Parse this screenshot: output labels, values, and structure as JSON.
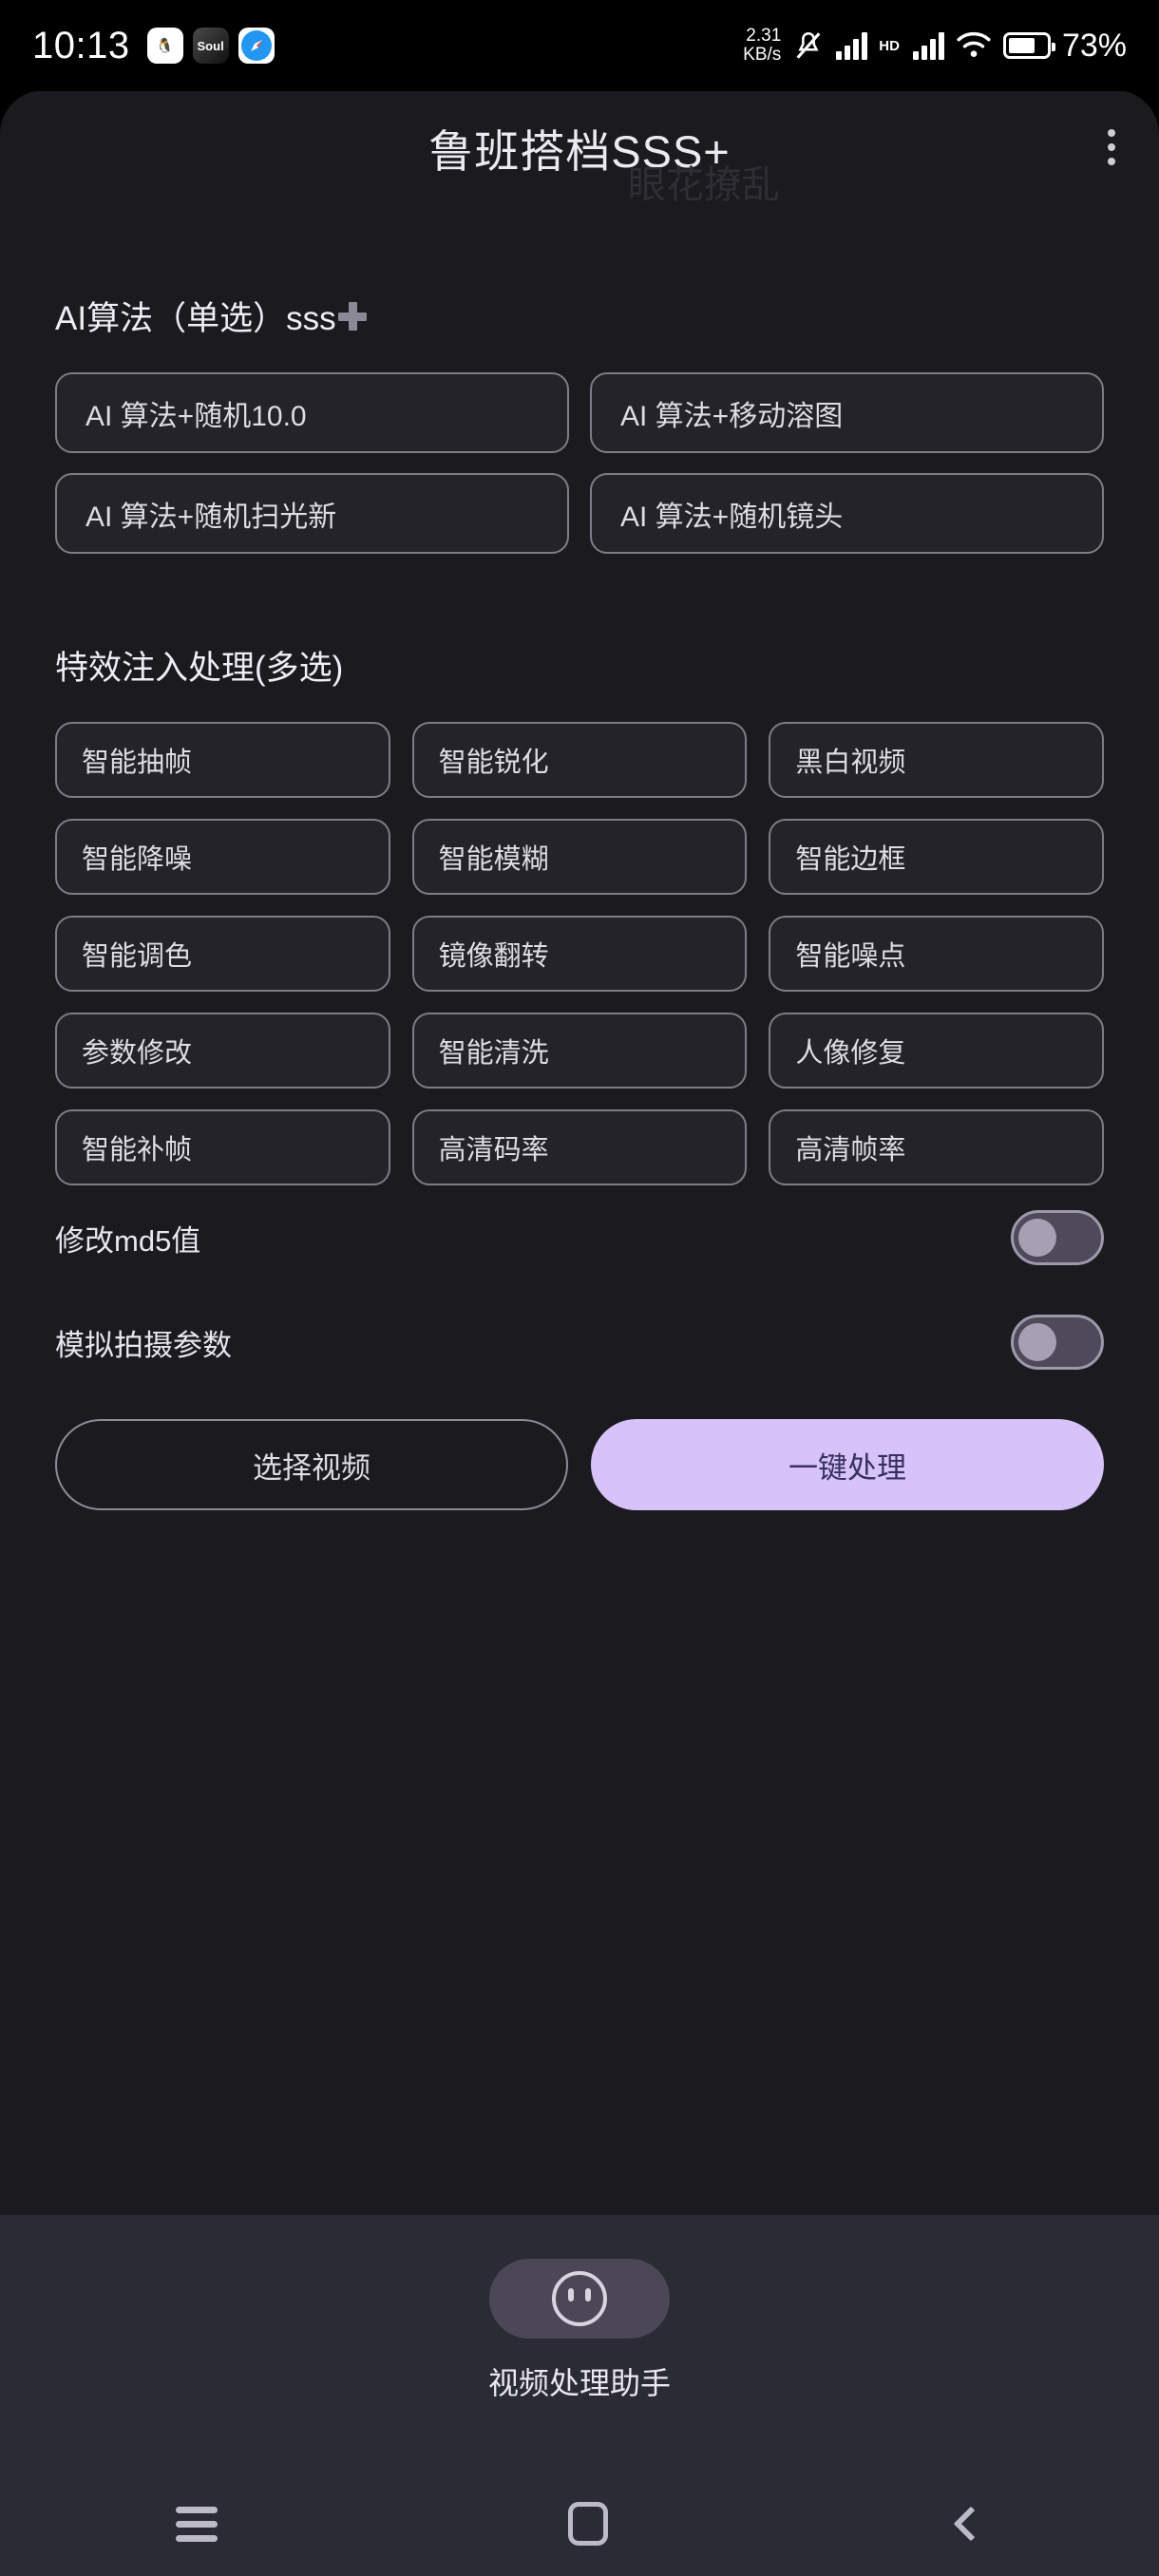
{
  "statusbar": {
    "clock": "10:13",
    "app_icons": [
      {
        "name": "qq-icon",
        "glyph": "🐧"
      },
      {
        "name": "soul-icon",
        "glyph": "Soul"
      },
      {
        "name": "safari-icon",
        "glyph": "🧭"
      }
    ],
    "net_speed_value": "2.31",
    "net_speed_unit": "KB/s",
    "hd_label": "HD",
    "battery_percent": "73%"
  },
  "header": {
    "title": "鲁班搭档SSS+",
    "watermark": "眼花撩乱",
    "menu_icon": "kebab-menu-icon"
  },
  "sections": {
    "algorithms": {
      "heading": "AI算法（单选）sss",
      "heading_icon": "plus-icon",
      "items": [
        "AI 算法+随机10.0",
        "AI 算法+移动溶图",
        "AI 算法+随机扫光新",
        "AI 算法+随机镜头"
      ]
    },
    "effects": {
      "heading": "特效注入处理(多选)",
      "items": [
        "智能抽帧",
        "智能锐化",
        "黑白视频",
        "智能降噪",
        "智能模糊",
        "智能边框",
        "智能调色",
        "镜像翻转",
        "智能噪点",
        "参数修改",
        "智能清洗",
        "人像修复",
        "智能补帧",
        "高清码率",
        "高清帧率"
      ]
    }
  },
  "toggles": [
    {
      "label": "修改md5值",
      "state": "off"
    },
    {
      "label": "模拟拍摄参数",
      "state": "off"
    }
  ],
  "actions": {
    "select_video": "选择视频",
    "one_click_process": "一键处理"
  },
  "assistant": {
    "icon": "smiley-face-icon",
    "label": "视频处理助手"
  },
  "navbar": {
    "recents": "recents-icon",
    "home": "home-icon",
    "back": "back-icon"
  },
  "colors": {
    "accent": "#d8c2fa",
    "card_bg": "#1a1a1f",
    "lower_bg": "#2b2b35",
    "border": "#7d7d88"
  }
}
